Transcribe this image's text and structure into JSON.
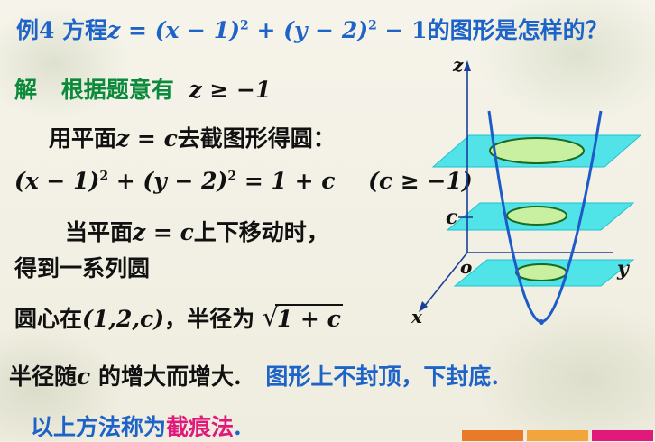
{
  "header": {
    "example_label": "例4",
    "question_prefix": "方程",
    "question_equation": "z = (x − 1)",
    "sq1": "2",
    "eq_mid": " + (y − 2)",
    "sq2": "2",
    "eq_end": " − 1",
    "question_suffix": "的图形是怎样的？"
  },
  "solution": {
    "label": "解",
    "line1_text": "根据题意有",
    "line1_math": "z ≥ −1",
    "line2_text_a": "用平面",
    "line2_math": "z = c",
    "line2_text_b": "去截图形得圆：",
    "line3_a": "(x − 1)",
    "line3_sq1": "2",
    "line3_b": " + (y − 2)",
    "line3_sq2": "2",
    "line3_c": " = 1 + c",
    "line3_cond": "(c ≥ −1)",
    "line4_text_a": "当平面",
    "line4_math": "z = c",
    "line4_text_b": "上下移动时，",
    "line5_text": "得到一系列圆",
    "line6_text_a": "圆心在",
    "line6_center": "(1,2,c)",
    "line6_text_b": "，半径为",
    "line6_radical_sign": "√",
    "line6_radical_body": "1 + c",
    "line7_text_a": "半径随",
    "line7_var": "c",
    "line7_text_b": " 的增大而增大.",
    "line7_blue": "图形上不封顶，下封底.",
    "line8_text_a": "以上方法称为",
    "line8_red": "截痕法",
    "line8_text_b": "."
  },
  "figure": {
    "axis_z": "z",
    "axis_y": "y",
    "axis_x": "x",
    "origin": "o",
    "plane_label": "c"
  },
  "colors": {
    "title_blue": "#1e63c8",
    "solution_green": "#0a8a3a",
    "highlight_red": "#e0197a",
    "plane_cyan": "#34e0e8",
    "ellipse_green": "#c8f0a0",
    "paraboloid_blue": "#1e5bc8",
    "axis_color": "#1a3f9a"
  }
}
